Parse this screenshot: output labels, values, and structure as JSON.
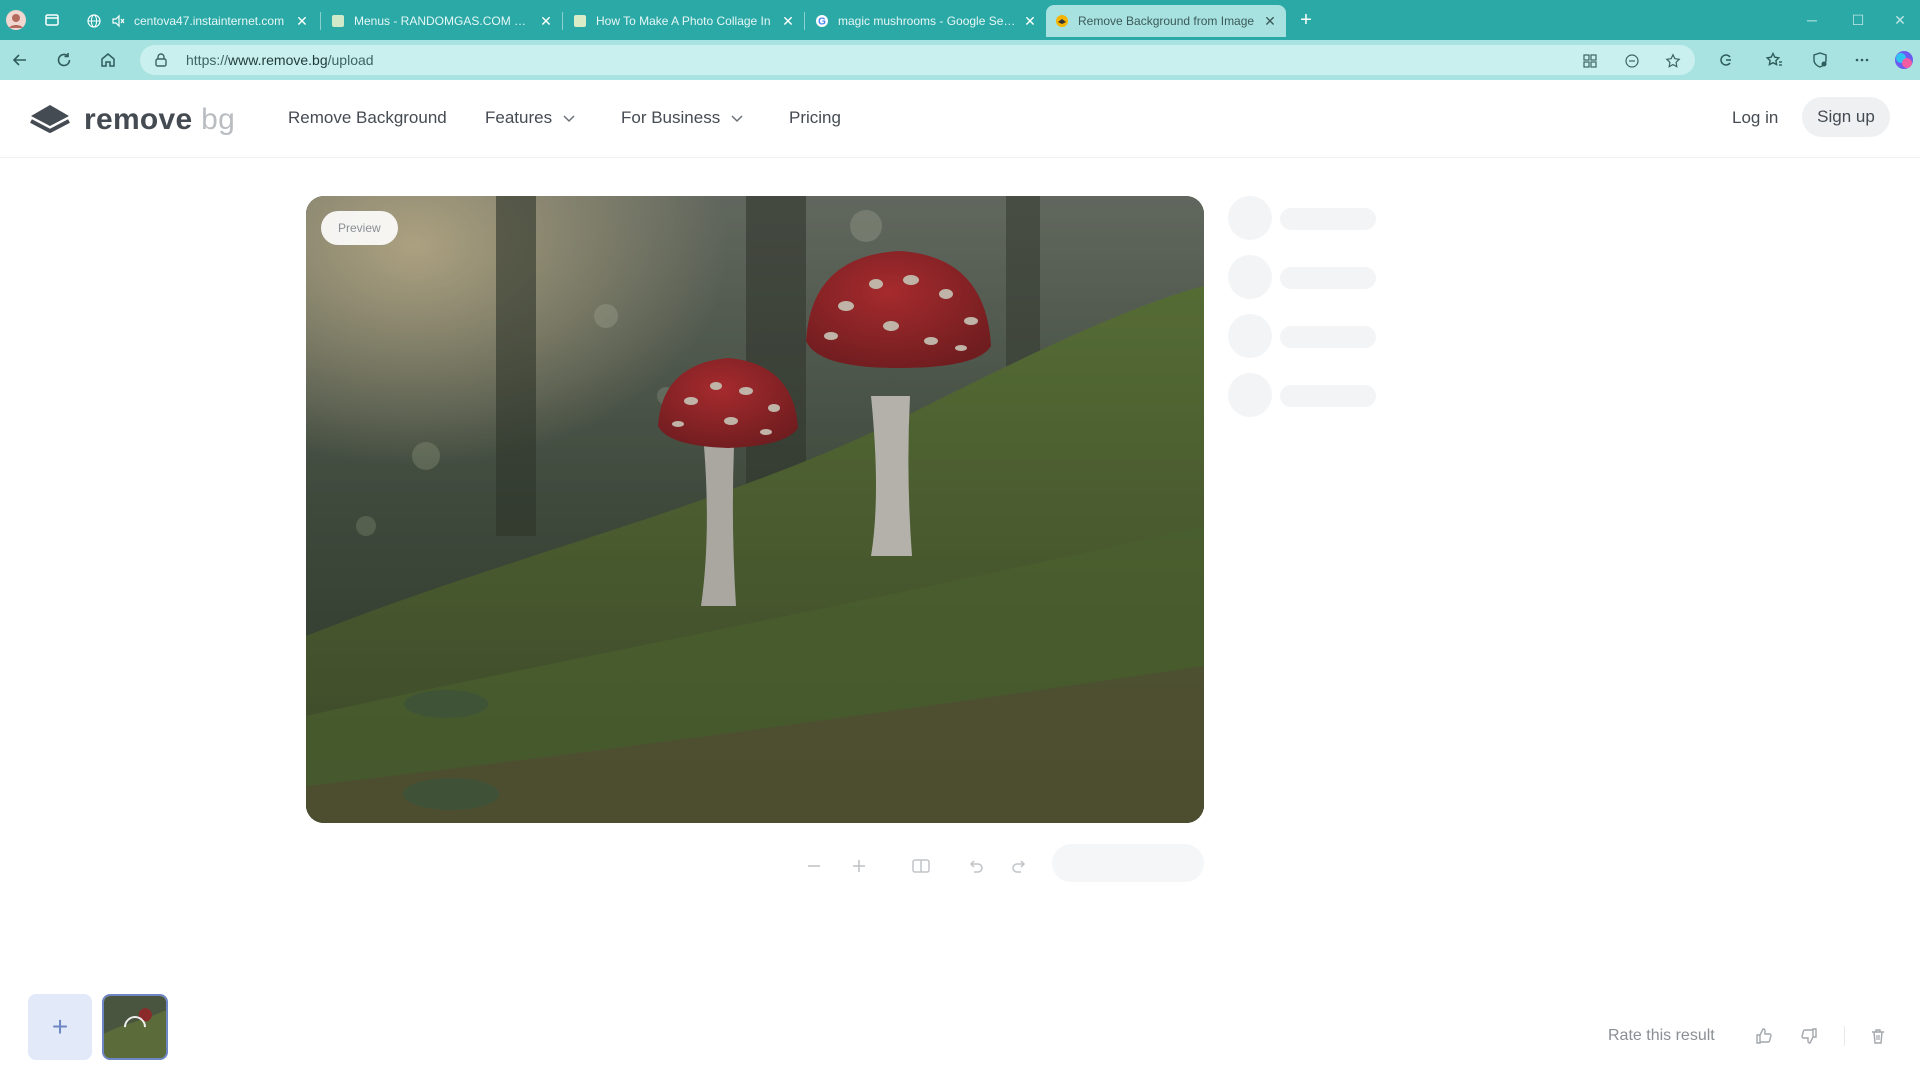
{
  "browser": {
    "tabs": [
      {
        "label": "centova47.instainternet.com",
        "favicon": "globe-icon",
        "muted": true
      },
      {
        "label": "Menus - RANDOMGAS.COM — It",
        "favicon": "page-icon"
      },
      {
        "label": "How To Make A Photo Collage In",
        "favicon": "page-icon"
      },
      {
        "label": "magic mushrooms - Google Search",
        "favicon": "google-icon"
      },
      {
        "label": "Remove Background from Image",
        "favicon": "removebg-icon",
        "active": true
      }
    ],
    "url_scheme": "https://",
    "url_domain": "www.remove.bg",
    "url_path": "/upload"
  },
  "site": {
    "logo_main": "remove",
    "logo_light": "bg",
    "nav": {
      "remove_background": "Remove Background",
      "features": "Features",
      "for_business": "For Business",
      "pricing": "Pricing"
    },
    "login": "Log in",
    "signup": "Sign up"
  },
  "preview": {
    "badge": "Preview"
  },
  "bottom": {
    "add_symbol": "+",
    "rate_label": "Rate this result"
  },
  "colors": {
    "tabbar": "#2aa9a6",
    "toolbar": "#a8e3e1",
    "accent": "#6f86c4"
  }
}
